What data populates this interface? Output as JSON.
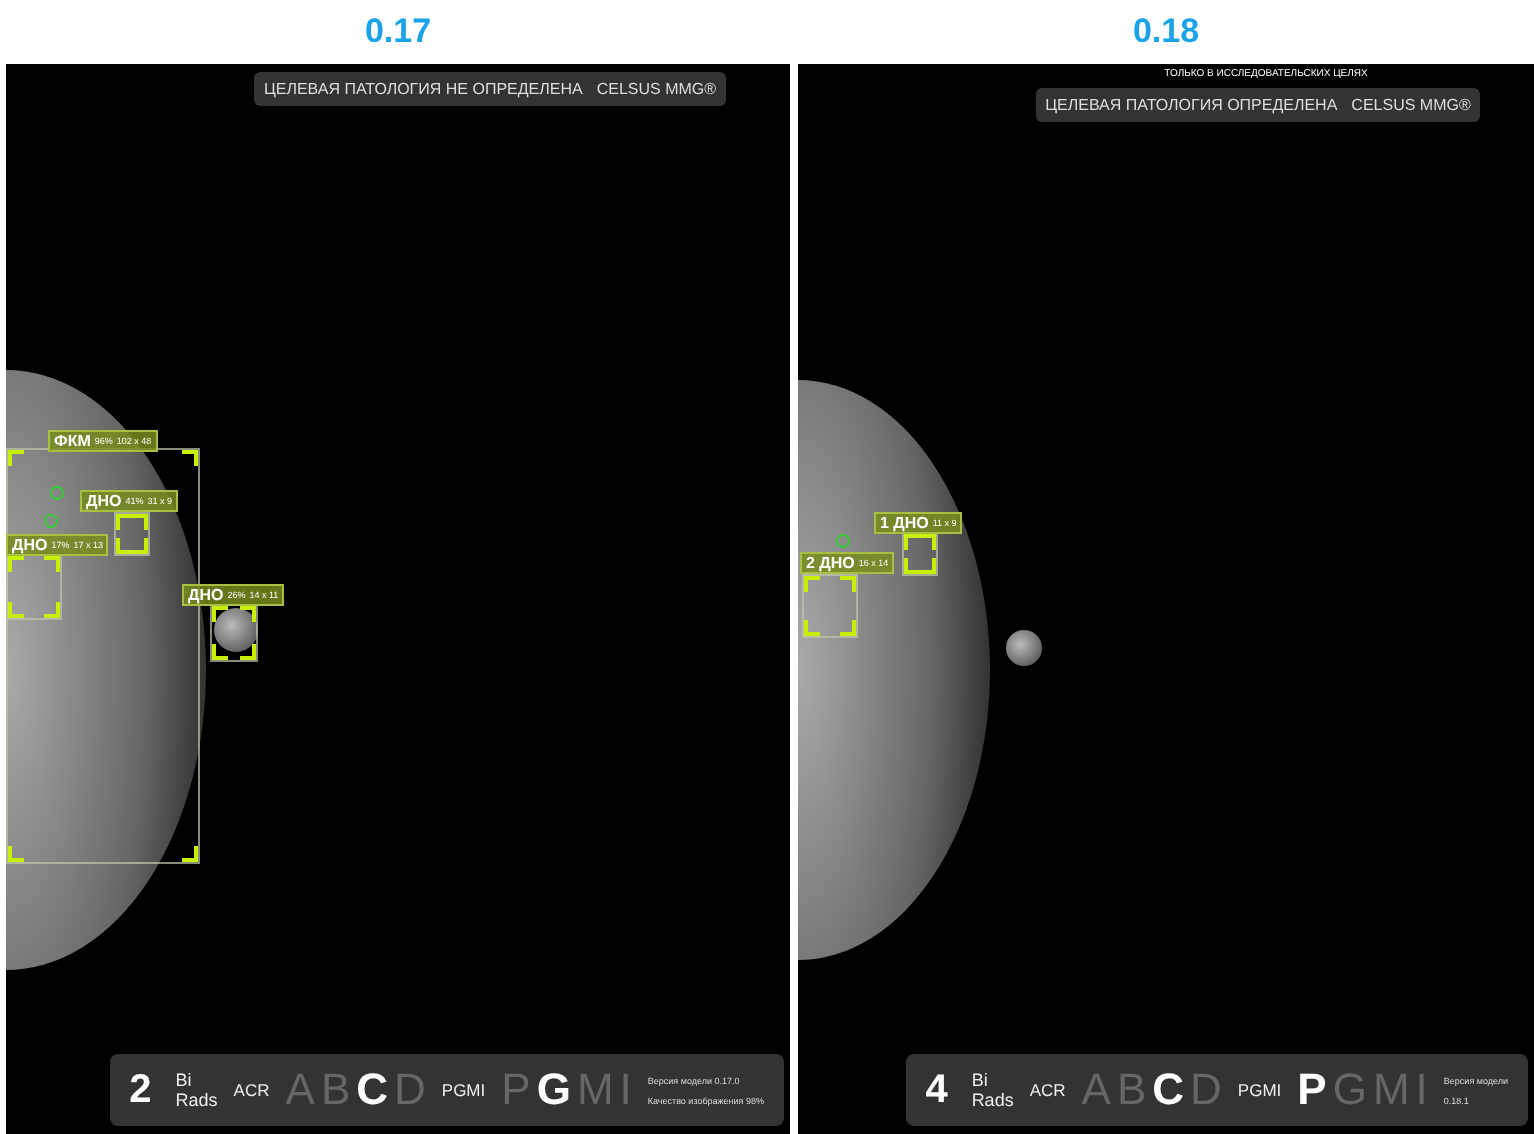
{
  "panels": [
    {
      "version_title": "0.17",
      "banner": {
        "status": "ЦЕЛЕВАЯ ПАТОЛОГИЯ НЕ ОПРЕДЕЛЕНА",
        "product": "CELSUS MMG®"
      },
      "findings": [
        {
          "label": "ФКМ",
          "probability": "96%",
          "size": "102 x 48"
        },
        {
          "label": "ДНО",
          "probability": "41%",
          "size": "31 x 9"
        },
        {
          "label": "ДНО",
          "probability": "17%",
          "size": "17 x 13"
        },
        {
          "label": "ДНО",
          "probability": "26%",
          "size": "14 x 11"
        }
      ],
      "summary": {
        "birads": "2",
        "birads_label": "Bi Rads",
        "acr": {
          "label": "ACR",
          "grades": [
            {
              "letter": "A",
              "selected": false
            },
            {
              "letter": "B",
              "selected": false
            },
            {
              "letter": "C",
              "selected": true
            },
            {
              "letter": "D",
              "selected": false
            }
          ]
        },
        "pgmi": {
          "label": "PGMI",
          "grades": [
            {
              "letter": "P",
              "selected": false
            },
            {
              "letter": "G",
              "selected": true
            },
            {
              "letter": "M",
              "selected": false
            },
            {
              "letter": "I",
              "selected": false
            }
          ]
        },
        "model_info": [
          "Версия модели 0.17.0",
          "Качество изображения 98%"
        ]
      }
    },
    {
      "version_title": "0.18",
      "note": "ТОЛЬКО В ИССЛЕДОВАТЕЛЬСКИХ ЦЕЛЯХ",
      "banner": {
        "status": "ЦЕЛЕВАЯ ПАТОЛОГИЯ ОПРЕДЕЛЕНА",
        "product": "CELSUS MMG®"
      },
      "findings": [
        {
          "label": "1 ДНО",
          "size": "11 x 9"
        },
        {
          "label": "2 ДНО",
          "size": "16 x 14"
        }
      ],
      "summary": {
        "birads": "4",
        "birads_label": "Bi Rads",
        "acr": {
          "label": "ACR",
          "grades": [
            {
              "letter": "A",
              "selected": false
            },
            {
              "letter": "B",
              "selected": false
            },
            {
              "letter": "C",
              "selected": true
            },
            {
              "letter": "D",
              "selected": false
            }
          ]
        },
        "pgmi": {
          "label": "PGMI",
          "grades": [
            {
              "letter": "P",
              "selected": true
            },
            {
              "letter": "G",
              "selected": false
            },
            {
              "letter": "M",
              "selected": false
            },
            {
              "letter": "I",
              "selected": false
            }
          ]
        },
        "model_info": [
          "Версия модели",
          "0.18.1"
        ]
      }
    }
  ]
}
